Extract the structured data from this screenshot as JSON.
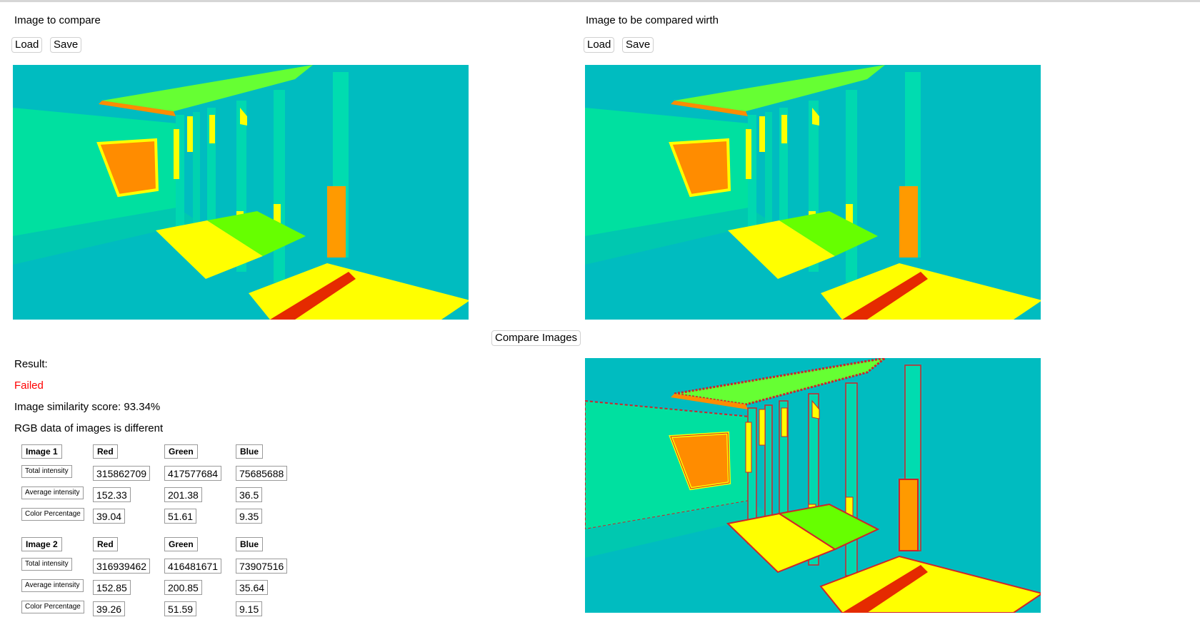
{
  "left_panel": {
    "title": "Image to compare",
    "load_label": "Load",
    "save_label": "Save"
  },
  "right_panel": {
    "title": "Image to be compared wirth",
    "load_label": "Load",
    "save_label": "Save"
  },
  "compare_button_label": "Compare Images",
  "result": {
    "label": "Result:",
    "status": "Failed",
    "similarity_text": "Image similarity score: 93.34%",
    "rgb_text": "RGB data of images is different"
  },
  "table1": {
    "headers": [
      "Image 1",
      "Red",
      "Green",
      "Blue"
    ],
    "rows": [
      {
        "label": "Total intensity",
        "values": [
          "315862709",
          "417577684",
          "75685688"
        ]
      },
      {
        "label": "Average intensity",
        "values": [
          "152.33",
          "201.38",
          "36.5"
        ]
      },
      {
        "label": "Color Percentage",
        "values": [
          "39.04",
          "51.61",
          "9.35"
        ]
      }
    ]
  },
  "table2": {
    "headers": [
      "Image 2",
      "Red",
      "Green",
      "Blue"
    ],
    "rows": [
      {
        "label": "Total intensity",
        "values": [
          "316939462",
          "416481671",
          "73907516"
        ]
      },
      {
        "label": "Average intensity",
        "values": [
          "152.85",
          "200.85",
          "35.64"
        ]
      },
      {
        "label": "Color Percentage",
        "values": [
          "39.26",
          "51.59",
          "9.15"
        ]
      }
    ]
  },
  "colors": {
    "failed_text": "#ff0000",
    "scene_background": "#00bcc0",
    "wall_green": "#00e0a0",
    "yellow": "#ffff00",
    "orange": "#ff8c00",
    "red": "#e52a00",
    "lime": "#66ff00",
    "diff_outline": "#d0232a"
  }
}
